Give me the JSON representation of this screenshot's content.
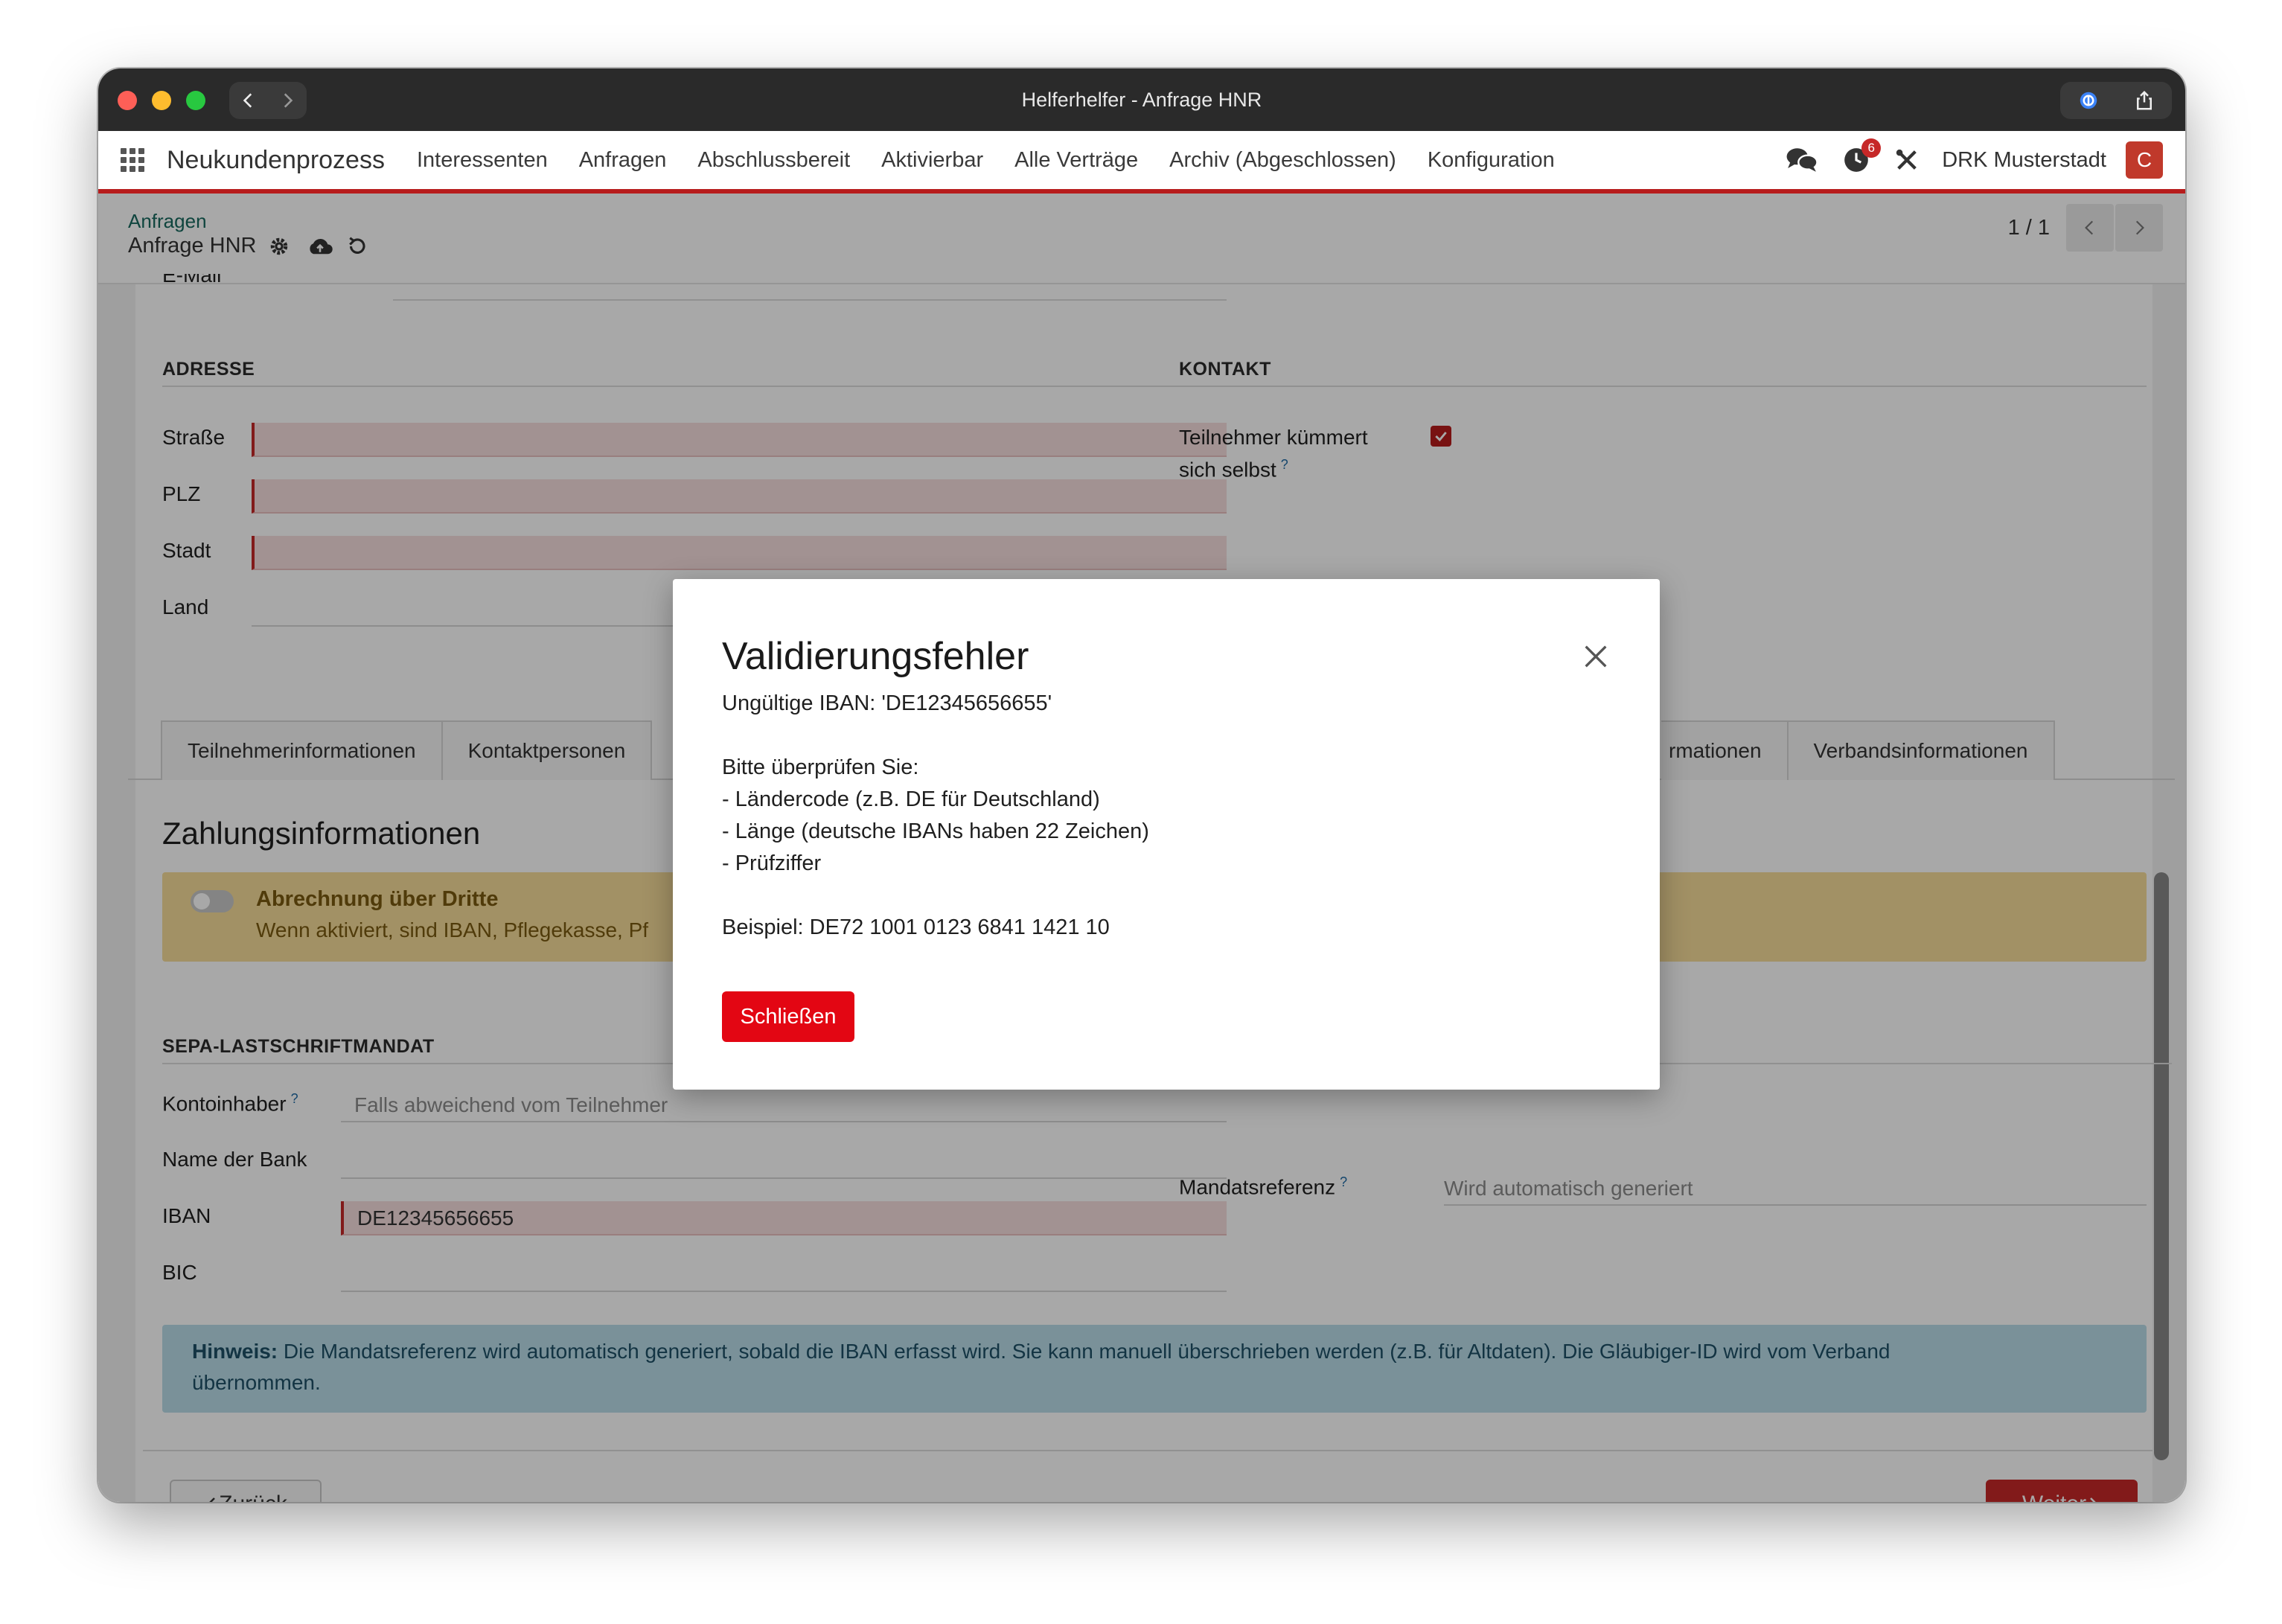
{
  "window": {
    "title": "Helferhelfer - Anfrage HNR"
  },
  "navbar": {
    "brand": "Neukundenprozess",
    "menu": [
      "Interessenten",
      "Anfragen",
      "Abschlussbereit",
      "Aktivierbar",
      "Alle Verträge",
      "Archiv (Abgeschlossen)",
      "Konfiguration"
    ],
    "activity_badge": "6",
    "company": "DRK Musterstadt",
    "avatar_letter": "C"
  },
  "control": {
    "breadcrumb_parent": "Anfragen",
    "breadcrumb_current": "Anfrage HNR",
    "pager": "1 / 1"
  },
  "form": {
    "cut_label": "E-Mail",
    "address": {
      "title": "ADRESSE",
      "street_label": "Straße",
      "zip_label": "PLZ",
      "city_label": "Stadt",
      "country_label": "Land"
    },
    "contact": {
      "title": "KONTAKT",
      "self_care_label_1": "Teilnehmer kümmert",
      "self_care_label_2": "sich selbst",
      "self_care_checked": true
    },
    "tabs": [
      "Teilnehmerinformationen",
      "Kontaktpersonen",
      "rmationen",
      "Verbandsinformationen"
    ],
    "payment": {
      "title": "Zahlungsinformationen",
      "third_party_title": "Abrechnung über Dritte",
      "third_party_text": "Wenn aktiviert, sind IBAN, Pflegekasse, Pf"
    },
    "sepa": {
      "title": "SEPA-LASTSCHRIFTMANDAT",
      "holder_label": "Kontoinhaber",
      "holder_placeholder": "Falls abweichend vom Teilnehmer",
      "bank_label": "Name der Bank",
      "iban_label": "IBAN",
      "iban_value": "DE12345656655",
      "bic_label": "BIC",
      "mandate_label": "Mandatsreferenz",
      "mandate_placeholder": "Wird automatisch generiert"
    },
    "hint": {
      "bold": "Hinweis:",
      "text_1": "Die Mandatsreferenz wird automatisch generiert, sobald die IBAN erfasst wird. Sie kann manuell überschrieben werden (z.B. für Altdaten). Die Gläubiger-ID wird vom Verband",
      "text_2": "übernommen."
    },
    "buttons": {
      "back": "Zurück",
      "next": "Weiter"
    }
  },
  "modal": {
    "title": "Validierungsfehler",
    "line_1": "Ungültige IBAN: 'DE12345656655'",
    "line_2": "Bitte überprüfen Sie:",
    "line_3": "- Ländercode (z.B. DE für Deutschland)",
    "line_4": "- Länge (deutsche IBANs haben 22 Zeichen)",
    "line_5": "- Prüfziffer",
    "line_6": "Beispiel: DE72 1001 0123 6841 1421 10",
    "close_label": "Schließen"
  },
  "colors": {
    "brand_red": "#b71c1c",
    "button_red": "#e30613",
    "warning_bg": "#f6dc9a",
    "info_bg": "#b9dde9"
  }
}
